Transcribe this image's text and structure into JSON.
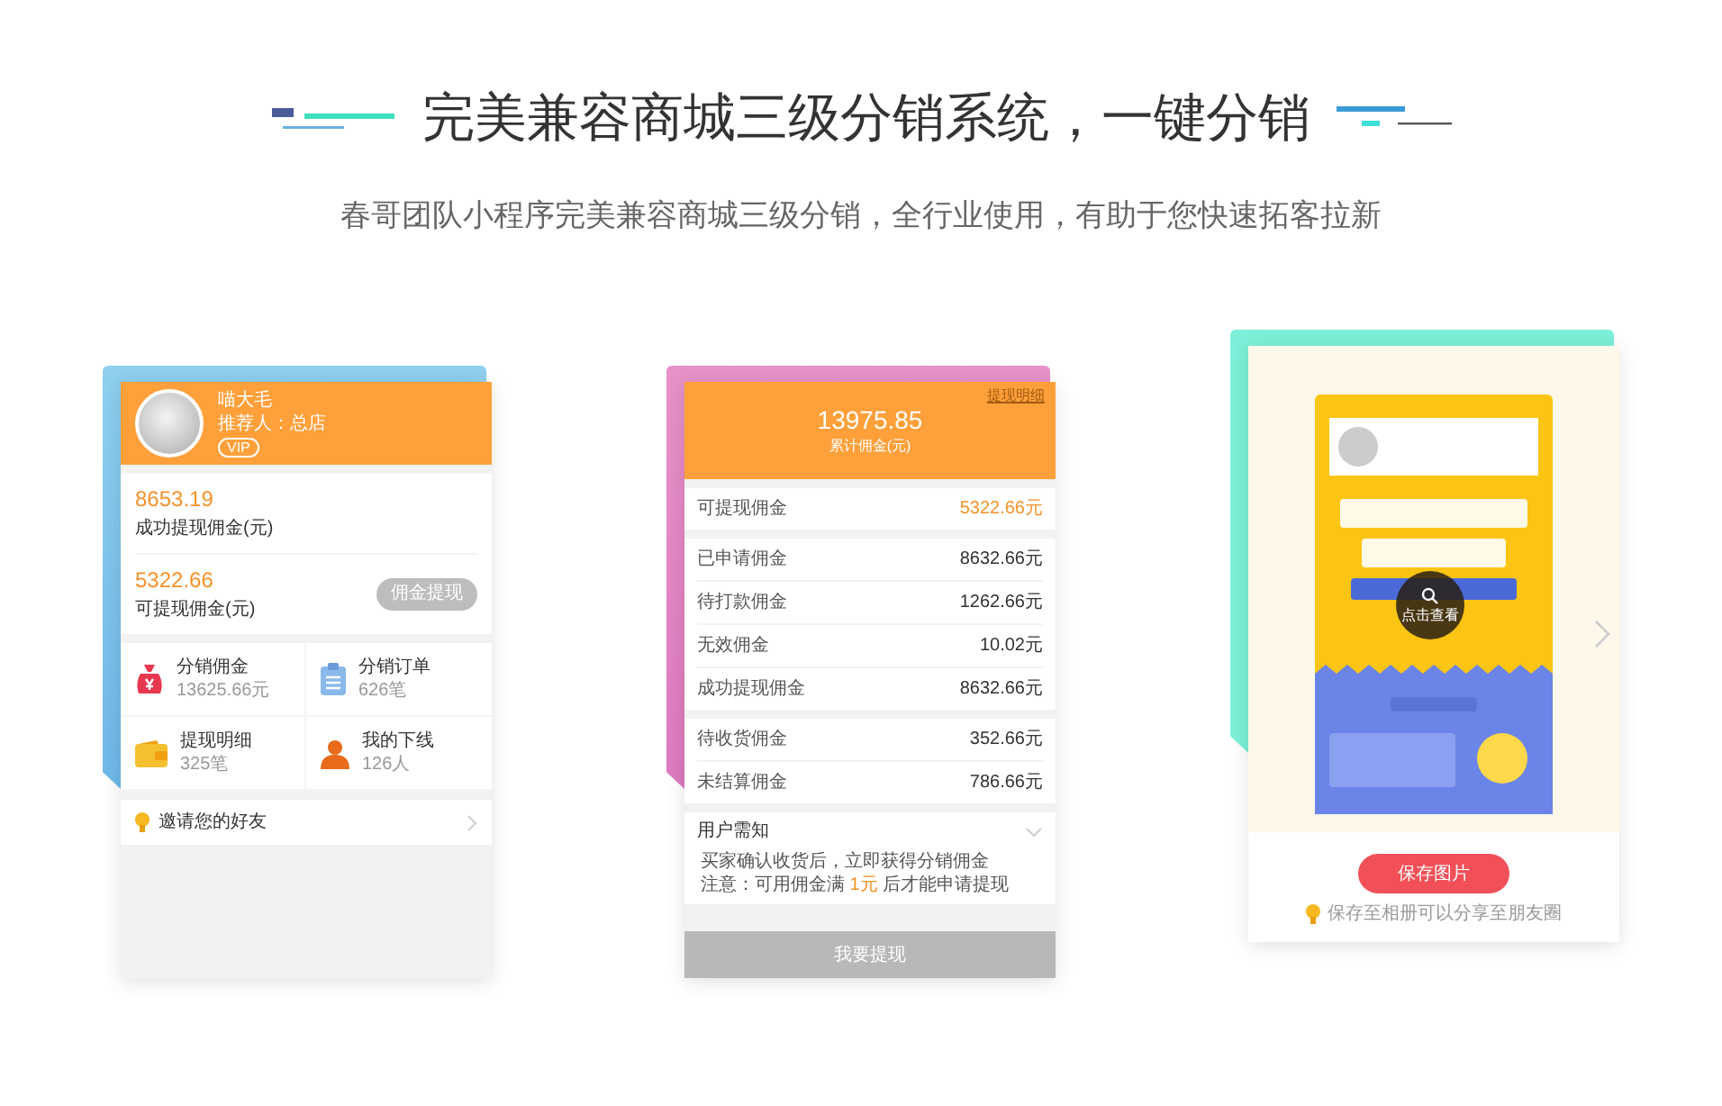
{
  "header": {
    "title": "完美兼容商城三级分销系统，一键分销",
    "subtitle": "春哥团队小程序完美兼容商城三级分销，全行业使用，有助于您快速拓客拉新"
  },
  "profile_card": {
    "name": "喵大毛",
    "referrer": "推荐人：总店",
    "badge": "VIP",
    "stats": [
      {
        "value": "8653.19",
        "label": "成功提现佣金(元)"
      },
      {
        "value": "5322.66",
        "label": "可提现佣金(元)",
        "action": {
          "label": "佣金提现",
          "disabled": true
        }
      }
    ],
    "menu": [
      {
        "kind": "money-bag",
        "title": "分销佣金",
        "detail": "13625.66元"
      },
      {
        "kind": "clipboard",
        "title": "分销订单",
        "detail": "626笔"
      },
      {
        "kind": "wallet",
        "title": "提现明细",
        "detail": "325笔"
      },
      {
        "kind": "person",
        "title": "我的下线",
        "detail": "126人"
      }
    ],
    "invite": "邀请您的好友"
  },
  "commission_card": {
    "link": "提现明细",
    "total": "13975.85",
    "total_label": "累计佣金(元)",
    "groups": [
      [
        {
          "label": "可提现佣金",
          "value": "5322.66元",
          "highlight": true
        }
      ],
      [
        {
          "label": "已申请佣金",
          "value": "8632.66元",
          "highlight": false
        },
        {
          "label": "待打款佣金",
          "value": "1262.66元",
          "highlight": false
        },
        {
          "label": "无效佣金",
          "value": "10.02元",
          "highlight": false
        },
        {
          "label": "成功提现佣金",
          "value": "8632.66元",
          "highlight": false
        }
      ],
      [
        {
          "label": "待收货佣金",
          "value": "352.66元",
          "highlight": false
        },
        {
          "label": "未结算佣金",
          "value": "786.66元",
          "highlight": false
        }
      ]
    ],
    "notice": {
      "title": "用户需知",
      "line": "买家确认收货后，立即获得分销佣金",
      "note_before": "注意：可用佣金满",
      "note_highlight": "1元",
      "note_after": "后才能申请提现"
    },
    "button": {
      "label": "我要提现",
      "disabled": true
    }
  },
  "poster_card": {
    "overlay": "点击查看",
    "save_button": "保存图片",
    "hint": "保存至相册可以分享至朋友圈"
  }
}
